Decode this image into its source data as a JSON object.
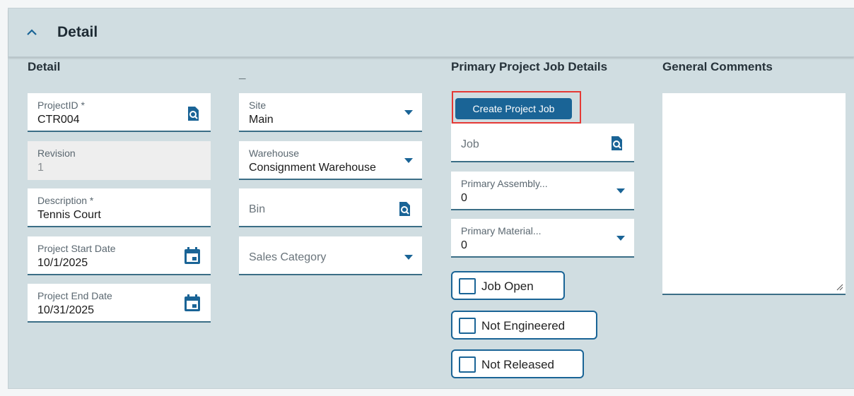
{
  "section": {
    "title": "Detail"
  },
  "columns": {
    "detail": {
      "title": "Detail"
    },
    "misc": {
      "title": "_"
    },
    "job": {
      "title": "Primary Project Job Details"
    },
    "comments": {
      "title": "General Comments",
      "value": ""
    }
  },
  "fields": {
    "project_id": {
      "label": "ProjectID *",
      "value": "CTR004",
      "icon": "search-icon"
    },
    "revision": {
      "label": "Revision",
      "value": "1"
    },
    "description": {
      "label": "Description *",
      "value": "Tennis Court"
    },
    "start_date": {
      "label": "Project Start Date",
      "value": "10/1/2025",
      "icon": "calendar-icon"
    },
    "end_date": {
      "label": "Project End Date",
      "value": "10/31/2025",
      "icon": "calendar-icon"
    },
    "site": {
      "label": "Site",
      "value": "Main"
    },
    "warehouse": {
      "label": "Warehouse",
      "value": "Consignment Warehouse"
    },
    "bin": {
      "placeholder": "Bin",
      "icon": "search-icon"
    },
    "sales_category": {
      "placeholder": "Sales Category"
    },
    "job": {
      "placeholder": "Job",
      "icon": "search-icon"
    },
    "primary_assembly": {
      "label": "Primary Assembly...",
      "value": "0"
    },
    "primary_material": {
      "label": "Primary Material...",
      "value": "0"
    }
  },
  "buttons": {
    "create_project_job": "Create Project Job"
  },
  "checkboxes": [
    {
      "label": "Job Open",
      "checked": false
    },
    {
      "label": "Not Engineered",
      "checked": false
    },
    {
      "label": "Not Released",
      "checked": false
    }
  ],
  "colors": {
    "accent": "#1a6496",
    "panel_bg": "#d0dde1",
    "highlight": "#e53935"
  }
}
